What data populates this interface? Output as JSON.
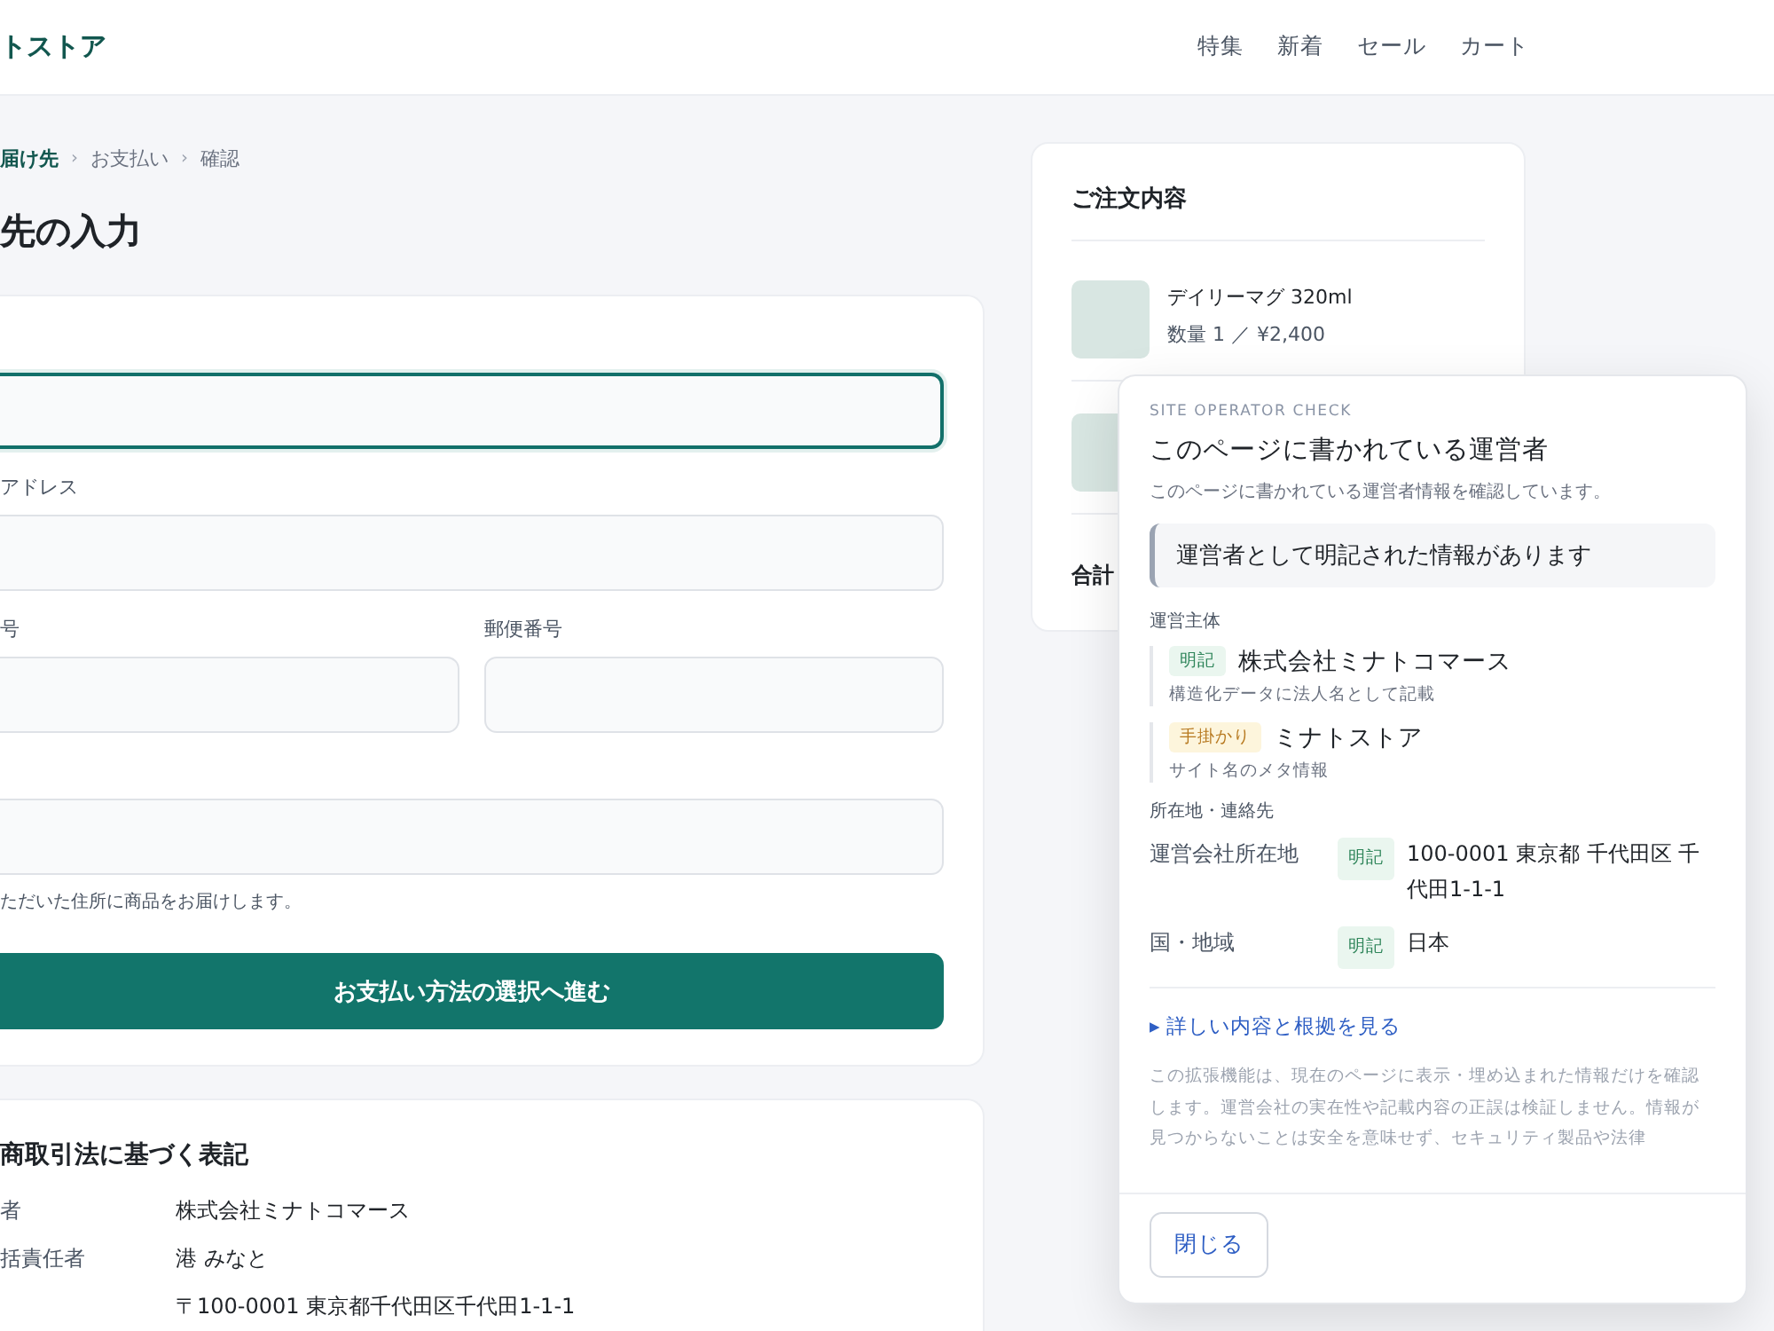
{
  "header": {
    "logo": "トストア",
    "nav": [
      {
        "label": "特集"
      },
      {
        "label": "新着"
      },
      {
        "label": "セール"
      },
      {
        "label": "カート"
      }
    ]
  },
  "breadcrumb": [
    {
      "label": "届け先",
      "selected": true
    },
    {
      "separator": "›",
      "label": "お支払い",
      "selected": false
    },
    {
      "separator": "›",
      "label": "確認",
      "selected": false
    }
  ],
  "page_title": "先の入力",
  "form": {
    "rows": [
      {
        "fields": [
          {
            "focused": true
          }
        ]
      },
      {
        "fields": [
          {
            "label": "アドレス",
            "focused": false
          }
        ]
      },
      {
        "fields": [
          {
            "label": "号",
            "focused": false
          },
          {
            "label": "郵便番号",
            "focused": false
          }
        ]
      },
      {
        "fields": [
          {
            "focused": false
          }
        ]
      }
    ],
    "hint": "ただいた住所に商品をお届けします。",
    "submit": "お支払い方法の選択へ進む"
  },
  "legal": {
    "title": "商取引法に基づく表記",
    "rows": [
      {
        "label": "者",
        "value": "株式会社ミナトコマース"
      },
      {
        "label": "括責任者",
        "value": "港 みなと"
      },
      {
        "value": "〒100-0001 東京都千代田区千代田1-1-1"
      }
    ]
  },
  "order_summary": {
    "title": "ご注文内容",
    "items": [
      {
        "kind": "product",
        "name": "デイリーマグ 320ml",
        "detail": "数量 1 ／ ¥2,400"
      },
      {
        "kind": "thumbnail_only"
      }
    ],
    "total_label": "合計"
  },
  "operator_popup": {
    "eyebrow": "SITE OPERATOR CHECK",
    "title": "このページに書かれている運営者",
    "subtitle": "このページに書かれている運営者情報を確認しています。",
    "result": "運営者として明記された情報があります",
    "operator_section": {
      "heading": "運営主体",
      "entries": [
        {
          "kind": "explicit",
          "badge": "明記",
          "value": "株式会社ミナトコマース",
          "note": "構造化データに法人名として記載"
        },
        {
          "kind": "hint",
          "badge": "手掛かり",
          "value": "ミナトストア",
          "note": "サイト名のメタ情報"
        }
      ]
    },
    "location_section": {
      "heading": "所在地・連絡先",
      "rows": [
        {
          "label": "運営会社所在地",
          "kind": "explicit",
          "badge": "明記",
          "value": "100-0001 東京都 千代田区 千代田1-1-1"
        },
        {
          "label": "国・地域",
          "kind": "explicit",
          "badge": "明記",
          "value": "日本"
        }
      ]
    },
    "details_link": "▸ 詳しい内容と根拠を見る",
    "disclaimer": "この拡張機能は、現在のページに表示・埋め込まれた情報だけを確認します。運営会社の実在性や記載内容の正誤は検証しません。情報が見つからないことは安全を意味せず、セキュリティ製品や法律",
    "close_button": "閉じる"
  }
}
